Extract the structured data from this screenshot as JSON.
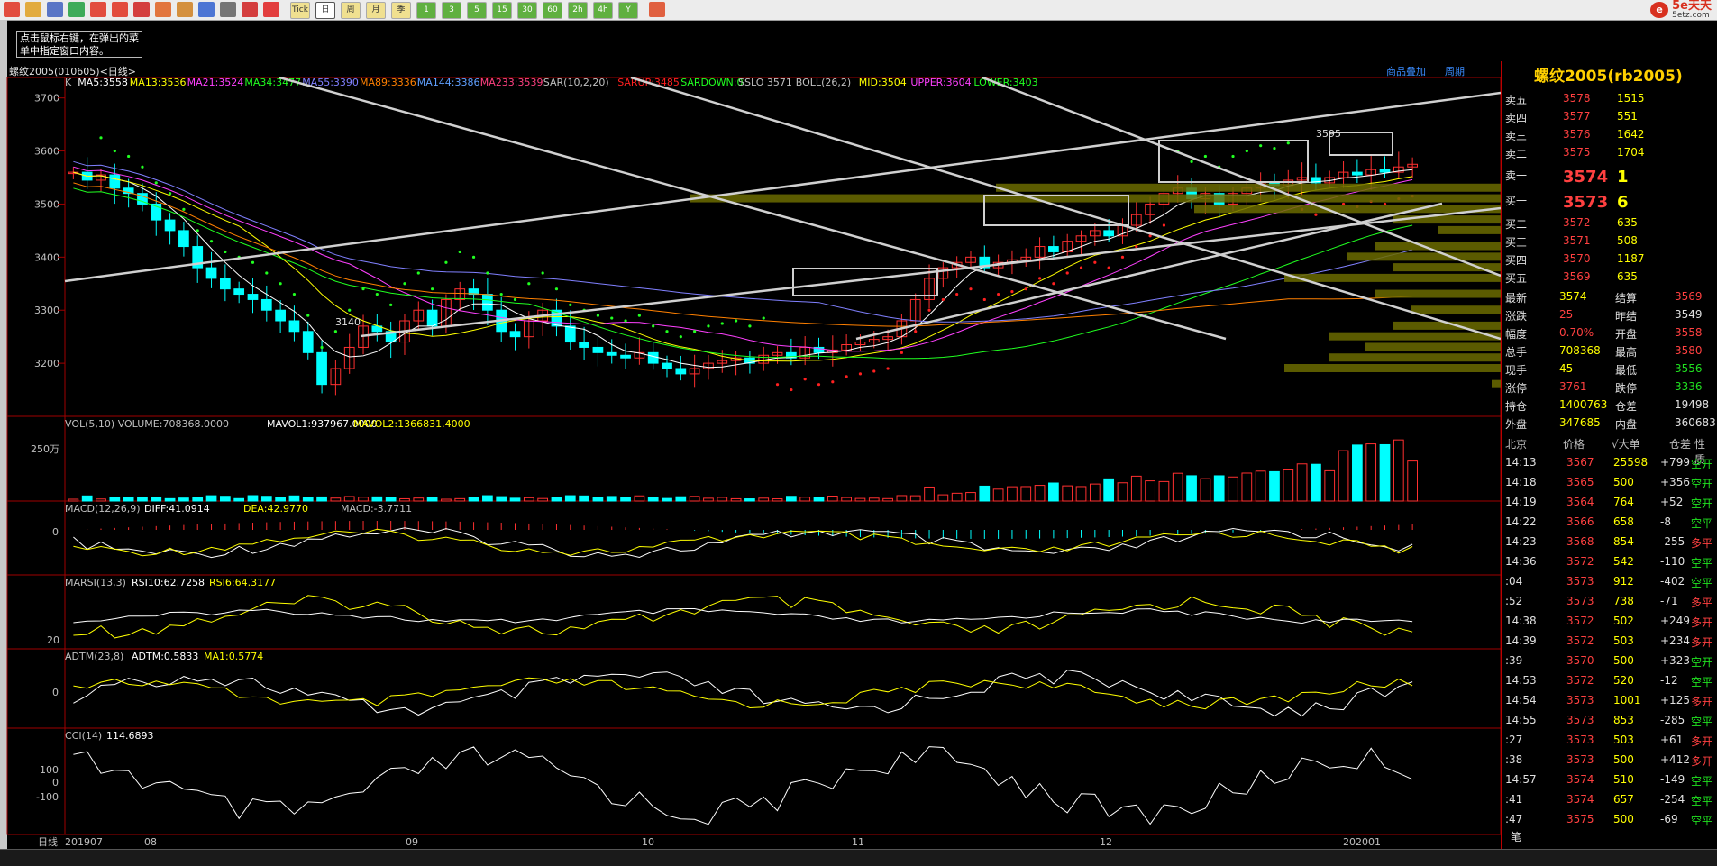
{
  "toolbar": {
    "icons": [
      "home-icon",
      "folder-icon",
      "stack-icon",
      "refresh-icon",
      "zoom-in-icon",
      "zoom-out-icon",
      "draw-icon",
      "brush-icon",
      "filter-icon",
      "news-icon",
      "table-icon",
      "line-chart-icon",
      "tick-icon",
      "day-icon",
      "week-icon",
      "month-icon",
      "season-icon",
      "x-icon",
      "one-min-icon",
      "three-min-icon",
      "five-min-icon",
      "fifteen-min-icon",
      "thirty-min-icon",
      "sixty-min-icon",
      "two-hour-icon",
      "four-hour-icon",
      "year-icon",
      "calc-icon"
    ],
    "buttons": [
      "Tick",
      "日",
      "周",
      "月",
      "季",
      "1",
      "3",
      "5",
      "15",
      "30",
      "60",
      "2h",
      "4h",
      "Y"
    ],
    "brand_name": "5e天天",
    "brand_sub": "5etz.com"
  },
  "tooltip": "点击鼠标右键，在弹出的菜单中指定窗口内容。",
  "chart_header": {
    "symbol": "螺纹2005(010605)<日线>",
    "right_links": [
      "商品叠加",
      "周期"
    ]
  },
  "main_indicators": [
    {
      "text": "K",
      "color": "#c0c0c0"
    },
    {
      "text": "MA5:3558",
      "color": "#ffffff"
    },
    {
      "text": "MA13:3536",
      "color": "#ffff00"
    },
    {
      "text": "MA21:3524",
      "color": "#ff40ff"
    },
    {
      "text": "MA34:3477",
      "color": "#20ff20"
    },
    {
      "text": "MA55:3390",
      "color": "#8080ff"
    },
    {
      "text": "MA89:3336",
      "color": "#ff8000"
    },
    {
      "text": "MA144:3386",
      "color": "#60a0ff"
    },
    {
      "text": "MA233:3539",
      "color": "#ff4080"
    },
    {
      "text": "SAR(10,2,20)",
      "color": "#c0c0c0"
    },
    {
      "text": "SARUP:3485",
      "color": "#ff2020"
    },
    {
      "text": "SARDOWN:0",
      "color": "#20ff20"
    },
    {
      "text": "SSLO 3571",
      "color": "#c0c0c0"
    },
    {
      "text": "BOLL(26,2)",
      "color": "#c0c0c0"
    },
    {
      "text": "MID:3504",
      "color": "#ffff00"
    },
    {
      "text": "UPPER:3604",
      "color": "#ff40ff"
    },
    {
      "text": "LOWER:3403",
      "color": "#20ff20"
    }
  ],
  "price_axis": [
    "3700",
    "3600",
    "3500",
    "3400",
    "3300",
    "3200"
  ],
  "annot_high": "3595",
  "annot_low": "3140",
  "vol_panel": {
    "label": "VOL(5,10) VOLUME:708368.0000",
    "mavol1": "MAVOL1:937967.0000",
    "mavol2": "MAVOL2:1366831.4000",
    "axis": "250万"
  },
  "macd_panel": {
    "label": "MACD(12,26,9)",
    "diff": "DIFF:41.0914",
    "dea": "DEA:42.9770",
    "macd": "MACD:-3.7711",
    "axis": "0"
  },
  "rsi_panel": {
    "label": "MARSI(13,3)",
    "rsi10": "RSI10:62.7258",
    "rsi6": "RSI6:64.3177",
    "axis": "20"
  },
  "adtm_panel": {
    "label": "ADTM(23,8)",
    "adtm": "ADTM:0.5833",
    "ma1": "MA1:0.5774",
    "axis": "0"
  },
  "cci_panel": {
    "label": "CCI(14)",
    "value": "114.6893",
    "axis": [
      "100",
      "0",
      "-100"
    ]
  },
  "time_axis": [
    "日线",
    "201907",
    "08",
    "09",
    "10",
    "11",
    "12",
    "202001"
  ],
  "quote": {
    "title": "螺纹2005(rb2005)",
    "asks": [
      [
        "卖五",
        "3578",
        "1515"
      ],
      [
        "卖四",
        "3577",
        "551"
      ],
      [
        "卖三",
        "3576",
        "1642"
      ],
      [
        "卖二",
        "3575",
        "1704"
      ],
      [
        "卖一",
        "3574",
        "1"
      ]
    ],
    "bids": [
      [
        "买一",
        "3573",
        "6"
      ],
      [
        "买二",
        "3572",
        "635"
      ],
      [
        "买三",
        "3571",
        "508"
      ],
      [
        "买四",
        "3570",
        "1187"
      ],
      [
        "买五",
        "3569",
        "635"
      ]
    ],
    "stats": [
      [
        "最新",
        "3574",
        "结算",
        "3569"
      ],
      [
        "涨跌",
        "25",
        "昨结",
        "3549"
      ],
      [
        "幅度",
        "0.70%",
        "开盘",
        "3558"
      ],
      [
        "总手",
        "708368",
        "最高",
        "3580"
      ],
      [
        "现手",
        "45",
        "最低",
        "3556"
      ],
      [
        "涨停",
        "3761",
        "跌停",
        "3336"
      ],
      [
        "持仓",
        "1400763",
        "仓差",
        "19498"
      ],
      [
        "外盘",
        "347685",
        "内盘",
        "360683"
      ]
    ],
    "trade_header": [
      "北京",
      "价格",
      "√大单",
      "仓差",
      "性质"
    ],
    "trades": [
      [
        "14:13",
        "3567",
        "25598",
        "+799",
        "空开"
      ],
      [
        "14:18",
        "3565",
        "500",
        "+356",
        "空开"
      ],
      [
        "14:19",
        "3564",
        "764",
        "+52",
        "空开"
      ],
      [
        "14:22",
        "3566",
        "658",
        "-8",
        "空平"
      ],
      [
        "14:23",
        "3568",
        "854",
        "-255",
        "多平"
      ],
      [
        "14:36",
        "3572",
        "542",
        "-110",
        "空平"
      ],
      [
        ":04",
        "3573",
        "912",
        "-402",
        "空平"
      ],
      [
        ":52",
        "3573",
        "738",
        "-71",
        "多平"
      ],
      [
        "14:38",
        "3572",
        "502",
        "+249",
        "多开"
      ],
      [
        "14:39",
        "3572",
        "503",
        "+234",
        "多开"
      ],
      [
        ":39",
        "3570",
        "500",
        "+323",
        "空开"
      ],
      [
        "14:53",
        "3572",
        "520",
        "-12",
        "空平"
      ],
      [
        "14:54",
        "3573",
        "1001",
        "+125",
        "多开"
      ],
      [
        "14:55",
        "3573",
        "853",
        "-285",
        "空平"
      ],
      [
        ":27",
        "3573",
        "503",
        "+61",
        "多开"
      ],
      [
        ":38",
        "3573",
        "500",
        "+412",
        "多开"
      ],
      [
        "14:57",
        "3574",
        "510",
        "-149",
        "空平"
      ],
      [
        ":41",
        "3574",
        "657",
        "-254",
        "空平"
      ],
      [
        ":47",
        "3575",
        "500",
        "-69",
        "空平"
      ]
    ],
    "footer_tab": "笔"
  }
}
